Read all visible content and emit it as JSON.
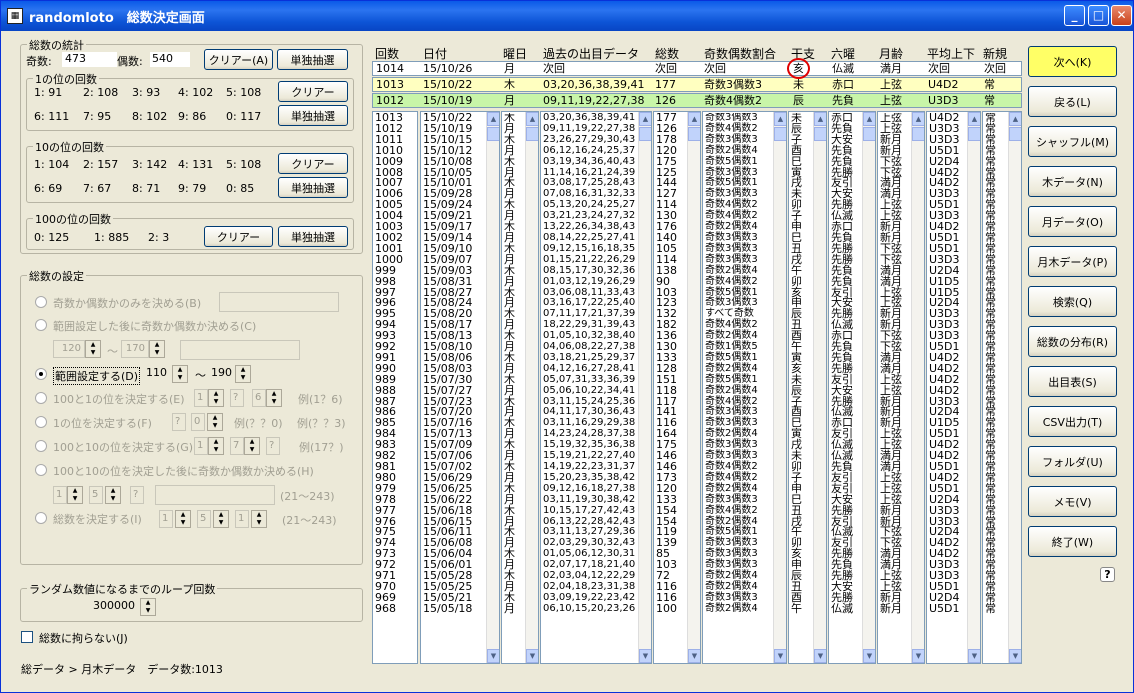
{
  "window": {
    "title": "randomloto　総数決定画面"
  },
  "stats": {
    "legend": "総数の統計",
    "odd_label": "奇数:",
    "odd_value": "473",
    "even_label": "偶数:",
    "even_value": "540",
    "clear_label": "クリアー(A)",
    "single_label": "単独抽選",
    "ones": {
      "legend": "1の位の回数",
      "row1": [
        "1: 91",
        "2: 108",
        "3: 93",
        "4: 102",
        "5: 108"
      ],
      "row2": [
        "6: 111",
        "7: 95",
        "8: 102",
        "9: 86",
        "0: 117"
      ],
      "clear_label": "クリアー",
      "single_label": "単独抽選"
    },
    "tens": {
      "legend": "10の位の回数",
      "row1": [
        "1: 104",
        "2: 157",
        "3: 142",
        "4: 131",
        "5: 108"
      ],
      "row2": [
        "6: 69",
        "7: 67",
        "8: 71",
        "9: 79",
        "0: 85"
      ],
      "clear_label": "クリアー",
      "single_label": "単独抽選"
    },
    "hundreds": {
      "legend": "100の位の回数",
      "values": [
        "0: 125",
        "1: 885",
        "2: 3"
      ],
      "clear_label": "クリアー",
      "single_label": "単独抽選"
    }
  },
  "settings": {
    "legend": "総数の設定",
    "opt1": "奇数か偶数かのみを決める(B)",
    "opt2": "範囲設定した後に奇数か偶数か決める(C)",
    "opt2_min": "120",
    "opt2_tilde": "〜",
    "opt2_max": "170",
    "opt3": "範囲設定する(D)",
    "opt3_min": "110",
    "opt3_tilde": "〜",
    "opt3_max": "190",
    "opt4": "100と1の位を決定する(E)",
    "opt4_v1": "1",
    "opt4_v2": "?",
    "opt4_v3": "6",
    "opt4_ex": "例(1？6)",
    "opt5": "1の位を決定する(F)",
    "opt5_v1": "?",
    "opt5_v2": "0",
    "opt5_ex1": "例(？？0)",
    "opt5_ex2": "例(？？3)",
    "opt6": "100と10の位を決定する(G)",
    "opt6_v1": "1",
    "opt6_v2": "7",
    "opt6_v3": "?",
    "opt6_ex": "例(17？)",
    "opt7": "100と10の位を決定した後に奇数か偶数か決める(H)",
    "opt7_v1": "1",
    "opt7_v2": "5",
    "opt7_v3": "?",
    "opt7_range": "(21〜243)",
    "opt8": "総数を決定する(I)",
    "opt8_v1": "1",
    "opt8_v2": "5",
    "opt8_v3": "1",
    "opt8_range": "(21〜243)"
  },
  "loop": {
    "legend": "ランダム数値になるまでのループ回数",
    "value": "300000"
  },
  "ignore_label": "総数に拘らない(J)",
  "status": "総データ > 月木データ　データ数:1013",
  "headers": [
    "回数",
    "日付",
    "曜日",
    "過去の出目データ",
    "総数",
    "奇数偶数割合",
    "干支",
    "六曜",
    "月齢",
    "平均上下",
    "新規"
  ],
  "top_rows": [
    [
      "1014",
      "15/10/26",
      "月",
      "次回",
      "次回",
      "次回",
      "亥",
      "仏滅",
      "満月",
      "次回",
      "次回"
    ],
    [
      "1013",
      "15/10/22",
      "木",
      "03,20,36,38,39,41",
      "177",
      "奇数3偶数3",
      "未",
      "赤口",
      "上弦",
      "U4D2",
      "常"
    ],
    [
      "1012",
      "15/10/19",
      "月",
      "09,11,19,22,27,38",
      "126",
      "奇数4偶数2",
      "辰",
      "先負",
      "上弦",
      "U3D3",
      "常"
    ]
  ],
  "list": {
    "kaisu": [
      "1013",
      "1012",
      "1011",
      "1010",
      "1009",
      "1008",
      "1007",
      "1006",
      "1005",
      "1004",
      "1003",
      "1002",
      "1001",
      "1000",
      "999",
      "998",
      "997",
      "996",
      "995",
      "994",
      "993",
      "992",
      "991",
      "990",
      "989",
      "988",
      "987",
      "986",
      "985",
      "984",
      "983",
      "982",
      "981",
      "980",
      "979",
      "978",
      "977",
      "976",
      "975",
      "974",
      "973",
      "972",
      "971",
      "970",
      "969",
      "968"
    ],
    "date": [
      "15/10/22",
      "15/10/19",
      "15/10/15",
      "15/10/12",
      "15/10/08",
      "15/10/05",
      "15/10/01",
      "15/09/28",
      "15/09/24",
      "15/09/21",
      "15/09/17",
      "15/09/14",
      "15/09/10",
      "15/09/07",
      "15/09/03",
      "15/08/31",
      "15/08/27",
      "15/08/24",
      "15/08/20",
      "15/08/17",
      "15/08/13",
      "15/08/10",
      "15/08/06",
      "15/08/03",
      "15/07/30",
      "15/07/27",
      "15/07/23",
      "15/07/20",
      "15/07/16",
      "15/07/13",
      "15/07/09",
      "15/07/06",
      "15/07/02",
      "15/06/29",
      "15/06/25",
      "15/06/22",
      "15/06/18",
      "15/06/15",
      "15/06/11",
      "15/06/08",
      "15/06/04",
      "15/06/01",
      "15/05/28",
      "15/05/25",
      "15/05/21",
      "15/05/18"
    ],
    "youbi": [
      "木",
      "月",
      "木",
      "月",
      "木",
      "月",
      "木",
      "月",
      "木",
      "月",
      "木",
      "月",
      "木",
      "月",
      "木",
      "月",
      "木",
      "月",
      "木",
      "月",
      "木",
      "月",
      "木",
      "月",
      "木",
      "月",
      "木",
      "月",
      "木",
      "月",
      "木",
      "月",
      "木",
      "月",
      "木",
      "月",
      "木",
      "月",
      "木",
      "月",
      "木",
      "月",
      "木",
      "月",
      "木",
      "月"
    ],
    "deme": [
      "03,20,36,38,39,41",
      "09,11,19,22,27,38",
      "23,26,27,29,30,43",
      "06,12,16,24,25,37",
      "03,19,34,36,40,43",
      "11,14,16,21,24,39",
      "03,08,17,25,28,43",
      "07,08,16,31,32,33",
      "05,13,20,24,25,27",
      "03,21,23,24,27,32",
      "13,22,26,34,38,43",
      "08,14,22,25,27,41",
      "09,12,15,16,18,35",
      "01,15,21,22,26,29",
      "08,15,17,30,32,36",
      "01,03,12,19,26,29",
      "03,06,08,11,33,43",
      "03,16,17,22,25,40",
      "07,11,17,21,37,39",
      "18,22,29,31,39,43",
      "01,05,10,32,38,40",
      "04,06,08,22,27,38",
      "03,18,21,25,29,37",
      "04,12,16,27,28,41",
      "05,07,31,33,36,39",
      "05,06,10,22,34,41",
      "03,11,15,24,25,36",
      "04,11,17,30,36,43",
      "03,11,16,29,29,38",
      "14,23,24,28,37,38",
      "15,19,32,35,36,38",
      "15,19,21,22,27,40",
      "14,19,22,23,31,37",
      "15,20,23,35,38,42",
      "09,12,16,18,27,38",
      "03,11,19,30,38,42",
      "10,15,17,27,42,43",
      "06,13,22,28,42,43",
      "03,11,13,27,29,36",
      "02,03,29,30,32,43",
      "01,05,06,12,30,31",
      "02,07,17,18,21,40",
      "02,03,04,12,22,29",
      "02,04,18,23,31,38",
      "03,09,19,22,23,42",
      "06,10,15,20,23,26"
    ],
    "sosu": [
      "177",
      "126",
      "178",
      "120",
      "175",
      "125",
      "144",
      "127",
      "114",
      "130",
      "176",
      "140",
      "105",
      "114",
      "138",
      "90",
      "103",
      "123",
      "132",
      "182",
      "136",
      "130",
      "133",
      "128",
      "151",
      "118",
      "117",
      "141",
      "116",
      "164",
      "175",
      "146",
      "146",
      "173",
      "120",
      "133",
      "154",
      "154",
      "119",
      "139",
      "85",
      "103",
      "72",
      "116",
      "116",
      "100"
    ],
    "ratio": [
      "奇数3偶数3",
      "奇数4偶数2",
      "奇数3偶数3",
      "奇数2偶数4",
      "奇数5偶数1",
      "奇数3偶数3",
      "奇数5偶数1",
      "奇数3偶数3",
      "奇数4偶数2",
      "奇数4偶数2",
      "奇数2偶数4",
      "奇数3偶数3",
      "奇数3偶数3",
      "奇数3偶数3",
      "奇数2偶数4",
      "奇数4偶数2",
      "奇数5偶数1",
      "奇数3偶数3",
      "すべて奇数",
      "奇数4偶数2",
      "奇数2偶数4",
      "奇数1偶数5",
      "奇数5偶数1",
      "奇数2偶数4",
      "奇数5偶数1",
      "奇数2偶数4",
      "奇数4偶数2",
      "奇数3偶数3",
      "奇数3偶数3",
      "奇数2偶数4",
      "奇数3偶数3",
      "奇数3偶数3",
      "奇数4偶数2",
      "奇数4偶数2",
      "奇数2偶数4",
      "奇数3偶数3",
      "奇数4偶数2",
      "奇数2偶数4",
      "奇数5偶数1",
      "奇数3偶数3",
      "奇数3偶数3",
      "奇数3偶数3",
      "奇数2偶数4",
      "奇数2偶数4",
      "奇数3偶数3",
      "奇数2偶数4"
    ],
    "eto": [
      "未",
      "辰",
      "子",
      "酉",
      "巳",
      "寅",
      "戌",
      "未",
      "卯",
      "子",
      "申",
      "巳",
      "丑",
      "戌",
      "午",
      "卯",
      "亥",
      "申",
      "辰",
      "丑",
      "酉",
      "午",
      "寅",
      "亥",
      "未",
      "辰",
      "子",
      "酉",
      "巳",
      "寅",
      "戌",
      "未",
      "卯",
      "子",
      "申",
      "巳",
      "丑",
      "戌",
      "午",
      "卯",
      "亥",
      "申",
      "辰",
      "丑",
      "酉",
      "午"
    ],
    "rokuyo": [
      "赤口",
      "先負",
      "大安",
      "先負",
      "先負",
      "先勝",
      "友引",
      "大安",
      "先勝",
      "仏滅",
      "赤口",
      "先負",
      "先勝",
      "先勝",
      "先負",
      "先負",
      "友引",
      "大安",
      "先勝",
      "仏滅",
      "赤口",
      "先負",
      "先負",
      "先勝",
      "友引",
      "大安",
      "先勝",
      "仏滅",
      "赤口",
      "友引",
      "仏滅",
      "仏滅",
      "先負",
      "友引",
      "友引",
      "大安",
      "先勝",
      "友引",
      "仏滅",
      "友引",
      "先勝",
      "先負",
      "先勝",
      "大安",
      "先勝",
      "仏滅"
    ],
    "getsurei": [
      "上弦",
      "上弦",
      "新月",
      "新月",
      "下弦",
      "下弦",
      "満月",
      "満月",
      "上弦",
      "上弦",
      "新月",
      "新月",
      "下弦",
      "下弦",
      "満月",
      "満月",
      "上弦",
      "上弦",
      "新月",
      "新月",
      "下弦",
      "下弦",
      "満月",
      "満月",
      "上弦",
      "上弦",
      "新月",
      "新月",
      "新月",
      "上弦",
      "上弦",
      "満月",
      "満月",
      "上弦",
      "上弦",
      "上弦",
      "新月",
      "新月",
      "下弦",
      "下弦",
      "満月",
      "満月",
      "上弦",
      "上弦",
      "新月",
      "新月"
    ],
    "heikin": [
      "U4D2",
      "U3D3",
      "U3D3",
      "U5D1",
      "U2D4",
      "U4D2",
      "U4D2",
      "U3D3",
      "U5D1",
      "U3D3",
      "U4D2",
      "U5D1",
      "U5D1",
      "U3D3",
      "U2D4",
      "U1D5",
      "U1D5",
      "U2D4",
      "U3D3",
      "U3D3",
      "U3D3",
      "U5D1",
      "U4D2",
      "U4D2",
      "U4D2",
      "U4D2",
      "U3D3",
      "U2D4",
      "U1D5",
      "U5D1",
      "U4D2",
      "U4D2",
      "U5D1",
      "U4D2",
      "U5D1",
      "U2D4",
      "U3D3",
      "U3D3",
      "U2D4",
      "U4D2",
      "U4D2",
      "U3D3",
      "U3D3",
      "U5D1",
      "U2D4",
      "U5D1"
    ],
    "shinki": [
      "常",
      "常",
      "常",
      "常",
      "常",
      "常",
      "常",
      "常",
      "常",
      "常",
      "常",
      "常",
      "常",
      "常",
      "常",
      "常",
      "常",
      "常",
      "常",
      "常",
      "常",
      "常",
      "常",
      "常",
      "常",
      "常",
      "常",
      "常",
      "常",
      "常",
      "常",
      "常",
      "常",
      "常",
      "常",
      "常",
      "常",
      "常",
      "常",
      "常",
      "常",
      "常",
      "常",
      "常",
      "常",
      "常"
    ]
  },
  "buttons": [
    "次へ(K)",
    "戻る(L)",
    "シャッフル(M)",
    "木データ(N)",
    "月データ(O)",
    "月木データ(P)",
    "検索(Q)",
    "総数の分布(R)",
    "出目表(S)",
    "CSV出力(T)",
    "フォルダ(U)",
    "メモ(V)",
    "終了(W)"
  ],
  "help": "?"
}
